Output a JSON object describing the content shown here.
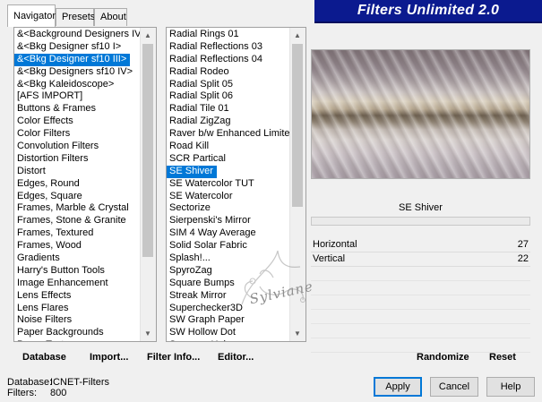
{
  "tabs": [
    "Navigator",
    "Presets",
    "About"
  ],
  "banner": "Filters Unlimited 2.0",
  "categories": [
    "&<Background Designers IV>",
    "&<Bkg Designer sf10 I>",
    "&<Bkg Designer sf10 III>",
    "&<Bkg Designers sf10 IV>",
    "&<Bkg Kaleidoscope>",
    "[AFS IMPORT]",
    "Buttons & Frames",
    "Color Effects",
    "Color Filters",
    "Convolution Filters",
    "Distortion Filters",
    "Distort",
    "Edges, Round",
    "Edges, Square",
    "Frames, Marble & Crystal",
    "Frames, Stone & Granite",
    "Frames, Textured",
    "Frames, Wood",
    "Gradients",
    "Harry's Button Tools",
    "Image Enhancement",
    "Lens Effects",
    "Lens Flares",
    "Noise Filters",
    "Paper Backgrounds",
    "Paper Textures"
  ],
  "categories_selected": 2,
  "filters": [
    "Radial  Rings 01",
    "Radial Reflections 03",
    "Radial Reflections 04",
    "Radial Rodeo",
    "Radial Split 05",
    "Radial Split 06",
    "Radial Tile 01",
    "Radial ZigZag",
    "Raver b/w Enhanced Limiter",
    "Road Kill",
    "SCR  Partical",
    "SE Shiver",
    "SE Watercolor TUT",
    "SE Watercolor",
    "Sectorize",
    "Sierpenski's Mirror",
    "SIM 4 Way Average",
    "Solid Solar Fabric",
    "Splash!...",
    "SpyroZag",
    "Square Bumps",
    "Streak Mirror",
    "Superchecker3D",
    "SW Graph Paper",
    "SW Hollow Dot",
    "Swapper Helper"
  ],
  "filters_selected": 11,
  "selected_filter_name": "SE Shiver",
  "params": [
    {
      "label": "Horizontal",
      "value": "27"
    },
    {
      "label": "Vertical",
      "value": "22"
    }
  ],
  "links": {
    "database": "Database",
    "import": "Import...",
    "filter_info": "Filter Info...",
    "editor": "Editor...",
    "randomize": "Randomize",
    "reset": "Reset"
  },
  "status": {
    "database_label": "Database:",
    "database_value": "ICNET-Filters",
    "filters_label": "Filters:",
    "filters_value": "800"
  },
  "buttons": {
    "apply": "Apply",
    "cancel": "Cancel",
    "help": "Help"
  },
  "watermark_text": "Sylviane"
}
